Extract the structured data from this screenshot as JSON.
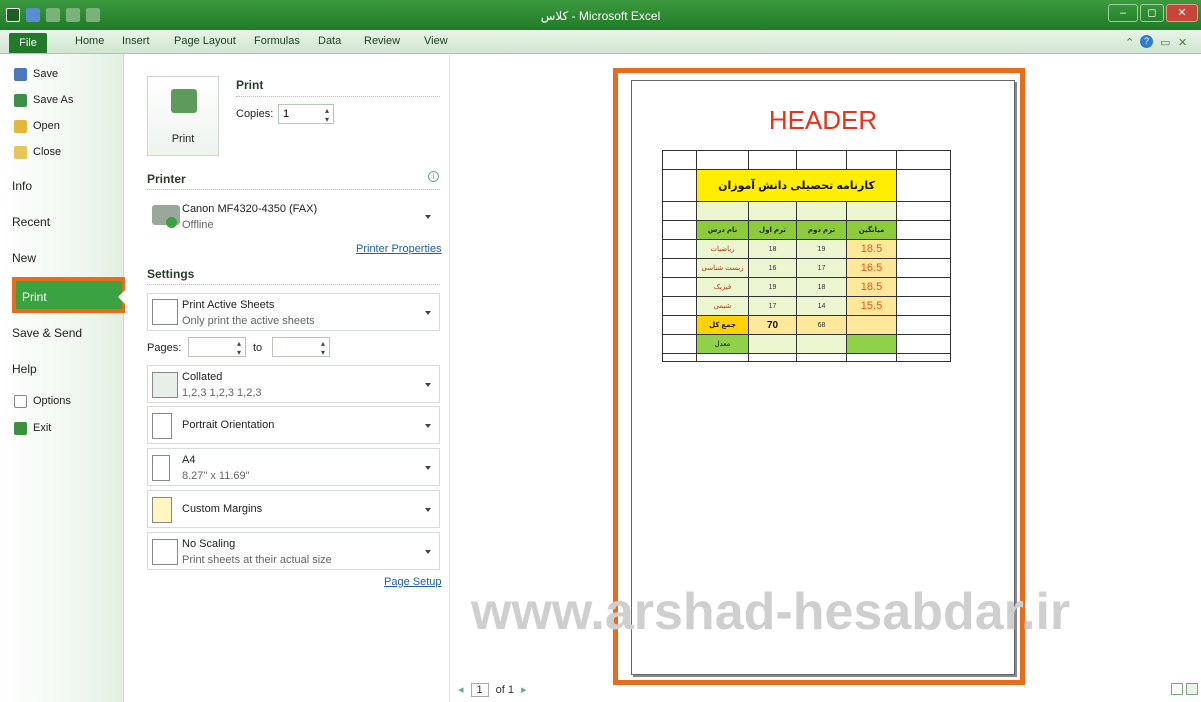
{
  "window": {
    "title": "کلاس - Microsoft Excel",
    "controls": [
      "–",
      "◻",
      "✕"
    ]
  },
  "tabs": {
    "file": "File",
    "items": [
      "Home",
      "Insert",
      "Page Layout",
      "Formulas",
      "Data",
      "Review",
      "View"
    ]
  },
  "nav": {
    "save": "Save",
    "save_as": "Save As",
    "open": "Open",
    "close": "Close",
    "info": "Info",
    "recent": "Recent",
    "new": "New",
    "print": "Print",
    "save_send": "Save & Send",
    "help": "Help",
    "options": "Options",
    "exit": "Exit"
  },
  "print_section": {
    "title": "Print",
    "copies_label": "Copies:",
    "copies_value": "1",
    "button_label": "Print"
  },
  "printer": {
    "heading": "Printer",
    "name": "Canon MF4320-4350 (FAX)",
    "status": "Offline",
    "properties_link": "Printer Properties",
    "info_icon": "info-icon"
  },
  "settings": {
    "heading": "Settings",
    "active": {
      "title": "Print Active Sheets",
      "sub": "Only print the active sheets"
    },
    "pages_label": "Pages:",
    "to_label": "to",
    "collated": {
      "title": "Collated",
      "sub": "1,2,3   1,2,3   1,2,3"
    },
    "orientation": "Portrait Orientation",
    "paper": {
      "title": "A4",
      "sub": "8.27\" x 11.69\""
    },
    "margins": "Custom Margins",
    "scaling": {
      "title": "No Scaling",
      "sub": "Print sheets at their actual size"
    },
    "page_setup_link": "Page Setup"
  },
  "preview": {
    "header": "HEADER",
    "watermark": "www.arshad-hesabdar.ir",
    "table_title": "کارنامه تحصیلی دانش آموزان",
    "col_headers": [
      "نام درس",
      "ترم اول",
      "ترم دوم",
      "میانگین"
    ],
    "rows": [
      [
        "ریاضیات",
        "18",
        "19",
        "18.5"
      ],
      [
        "زیست شناسی",
        "16",
        "17",
        "16.5"
      ],
      [
        "فیزیک",
        "19",
        "18",
        "18.5"
      ],
      [
        "شیمی",
        "17",
        "14",
        "15.5"
      ]
    ],
    "sum_label": "جمع کل",
    "sum_t1": "70",
    "sum_t2": "68",
    "avg_label": "معدل"
  },
  "page_nav": {
    "prev": "◂",
    "page": "1",
    "of": "of 1",
    "next": "▸"
  }
}
